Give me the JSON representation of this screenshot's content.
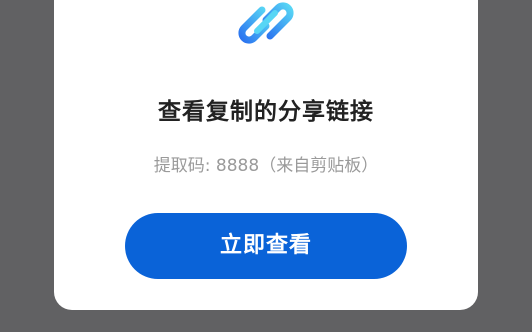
{
  "dialog": {
    "title": "查看复制的分享链接",
    "subtitle": "提取码: 8888（来自剪贴板）",
    "button_label": "立即查看",
    "icon": "link-icon"
  },
  "colors": {
    "accent": "#0a63d8",
    "icon_gradient_start": "#2b73f0",
    "icon_gradient_end": "#58d6f5",
    "overlay": "#616163"
  }
}
